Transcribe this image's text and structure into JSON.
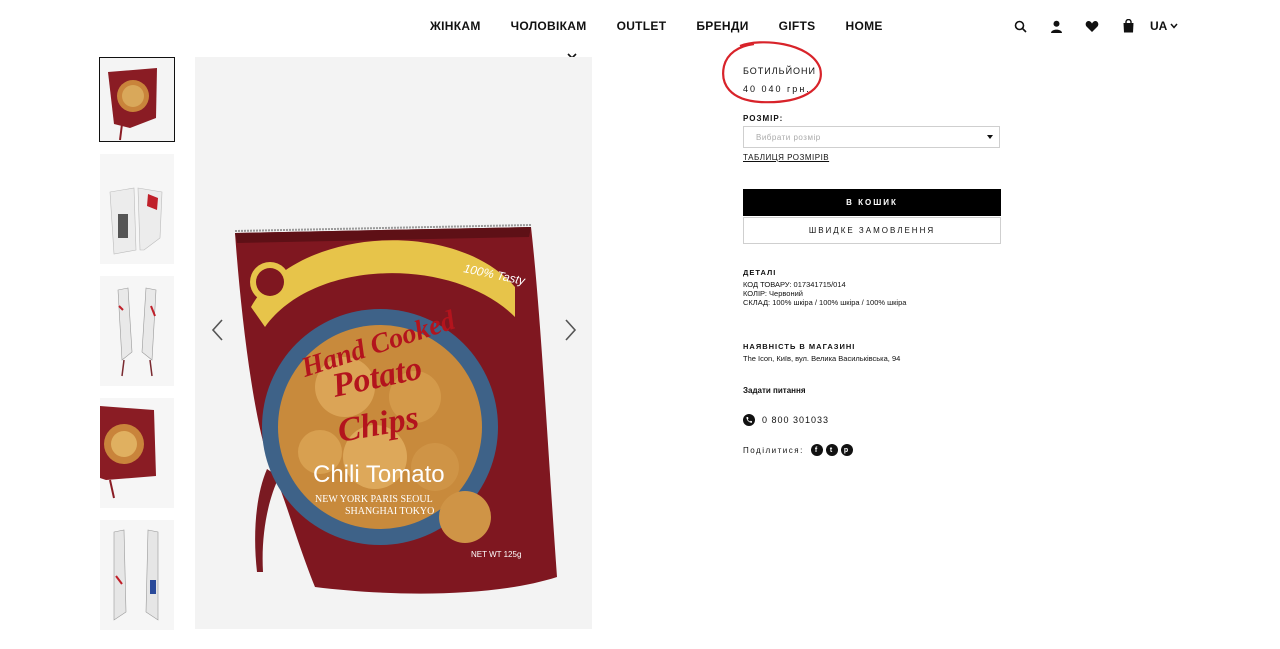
{
  "nav": {
    "items": [
      "ЖІНКАМ",
      "ЧОЛОВІКАМ",
      "OUTLET",
      "БРЕНДИ",
      "GIFTS",
      "HOME"
    ],
    "language": "UA",
    "icons": [
      "search-icon",
      "user-icon",
      "heart-icon",
      "bag-icon",
      "chevron-down-icon"
    ]
  },
  "gallery": {
    "thumbnails": [
      "thumbnail-1",
      "thumbnail-2",
      "thumbnail-3",
      "thumbnail-4",
      "thumbnail-5"
    ],
    "image_text": {
      "line1": "Hand Cooked",
      "line2": "Potato",
      "line3": "Chips",
      "flavor": "Chili Tomato",
      "cities1": "NEW YORK PARIS SEOUL",
      "cities2": "SHANGHAI TOKYO",
      "badge": "100% Tasty",
      "weight": "NET WT 125g"
    }
  },
  "product": {
    "name": "БОТИЛЬЙОНИ",
    "price": "40 040 грн.",
    "size_label": "РОЗМІР:",
    "size_placeholder": "Вибрати розмір",
    "size_table": "ТАБЛИЦЯ РОЗМІРІВ",
    "add_to_cart": "В КОШИК",
    "quick_order": "ШВИДКЕ ЗАМОВЛЕННЯ"
  },
  "details": {
    "title": "ДЕТАЛІ",
    "code": "КОД ТОВАРУ: 017341715/014",
    "color": "КОЛІР: Червоний",
    "composition": "СКЛАД: 100% шкіра / 100% шкіра / 100% шкіра"
  },
  "availability": {
    "title": "НАЯВНІСТЬ В МАГАЗИНІ",
    "store": "The Icon, Київ, вул. Велика Васильківська, 94"
  },
  "contact": {
    "ask": "Задати питання",
    "phone": "0 800 301033",
    "share_label": "Поділитися:"
  },
  "colors": {
    "accent": "#000000",
    "annotation": "#d8232a"
  }
}
